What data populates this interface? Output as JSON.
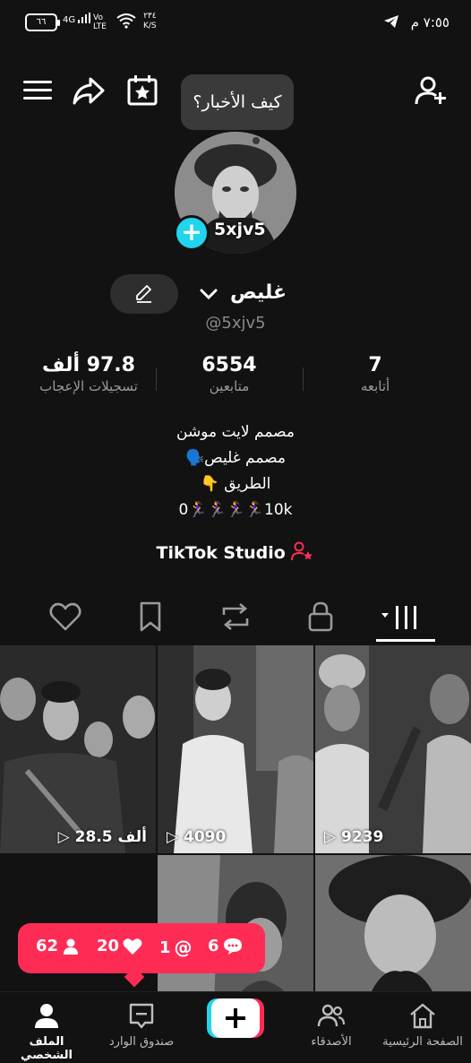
{
  "status_bar": {
    "time": "٧:٥٥",
    "period": "م",
    "battery": "٦٦",
    "network": "4G",
    "volte": "Vo LTE",
    "speed_value": "٢٣٤",
    "speed_unit": "K/S"
  },
  "profile": {
    "greeting_bubble": "كيف الأخبار؟",
    "avatar_watermark": "5xjv5",
    "display_name": "غليص",
    "handle": "@5xjv5",
    "stats": {
      "following": {
        "value": "7",
        "label": "أتابعه"
      },
      "followers": {
        "value": "6554",
        "label": "متابعين"
      },
      "likes": {
        "value": "97.8 ألف",
        "label": "تسجيلات الإعجاب"
      }
    },
    "bio_lines": [
      "مصمم لايت موشن",
      "مصمم غليص🗣️",
      "الطريق 👇",
      "0🏃‍♀️🏃‍♀️🏃‍♀️🏃‍♀️10k"
    ],
    "studio_link": "TikTok Studio"
  },
  "videos": [
    {
      "views": "28.5 ألف"
    },
    {
      "views": "4090"
    },
    {
      "views": "9239"
    },
    {
      "views": ""
    },
    {
      "views": ""
    }
  ],
  "notifications": {
    "followers": "62",
    "likes": "20",
    "mentions": "1",
    "comments": "6"
  },
  "bottom_nav": {
    "home": "الصفحة الرئيسية",
    "friends": "الأصدقاء",
    "inbox": "صندوق الوارد",
    "profile": "الملف الشخصي"
  },
  "colors": {
    "accent": "#fe2c55",
    "cyan": "#20d5ec",
    "background": "#121212"
  }
}
